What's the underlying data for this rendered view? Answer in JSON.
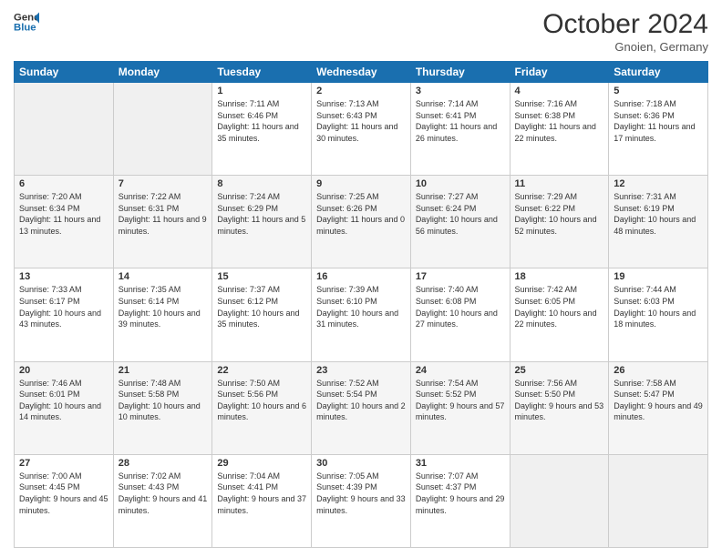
{
  "header": {
    "logo_line1": "General",
    "logo_line2": "Blue",
    "month_title": "October 2024",
    "location": "Gnoien, Germany"
  },
  "days_of_week": [
    "Sunday",
    "Monday",
    "Tuesday",
    "Wednesday",
    "Thursday",
    "Friday",
    "Saturday"
  ],
  "weeks": [
    [
      {
        "day": "",
        "sunrise": "",
        "sunset": "",
        "daylight": ""
      },
      {
        "day": "",
        "sunrise": "",
        "sunset": "",
        "daylight": ""
      },
      {
        "day": "1",
        "sunrise": "Sunrise: 7:11 AM",
        "sunset": "Sunset: 6:46 PM",
        "daylight": "Daylight: 11 hours and 35 minutes."
      },
      {
        "day": "2",
        "sunrise": "Sunrise: 7:13 AM",
        "sunset": "Sunset: 6:43 PM",
        "daylight": "Daylight: 11 hours and 30 minutes."
      },
      {
        "day": "3",
        "sunrise": "Sunrise: 7:14 AM",
        "sunset": "Sunset: 6:41 PM",
        "daylight": "Daylight: 11 hours and 26 minutes."
      },
      {
        "day": "4",
        "sunrise": "Sunrise: 7:16 AM",
        "sunset": "Sunset: 6:38 PM",
        "daylight": "Daylight: 11 hours and 22 minutes."
      },
      {
        "day": "5",
        "sunrise": "Sunrise: 7:18 AM",
        "sunset": "Sunset: 6:36 PM",
        "daylight": "Daylight: 11 hours and 17 minutes."
      }
    ],
    [
      {
        "day": "6",
        "sunrise": "Sunrise: 7:20 AM",
        "sunset": "Sunset: 6:34 PM",
        "daylight": "Daylight: 11 hours and 13 minutes."
      },
      {
        "day": "7",
        "sunrise": "Sunrise: 7:22 AM",
        "sunset": "Sunset: 6:31 PM",
        "daylight": "Daylight: 11 hours and 9 minutes."
      },
      {
        "day": "8",
        "sunrise": "Sunrise: 7:24 AM",
        "sunset": "Sunset: 6:29 PM",
        "daylight": "Daylight: 11 hours and 5 minutes."
      },
      {
        "day": "9",
        "sunrise": "Sunrise: 7:25 AM",
        "sunset": "Sunset: 6:26 PM",
        "daylight": "Daylight: 11 hours and 0 minutes."
      },
      {
        "day": "10",
        "sunrise": "Sunrise: 7:27 AM",
        "sunset": "Sunset: 6:24 PM",
        "daylight": "Daylight: 10 hours and 56 minutes."
      },
      {
        "day": "11",
        "sunrise": "Sunrise: 7:29 AM",
        "sunset": "Sunset: 6:22 PM",
        "daylight": "Daylight: 10 hours and 52 minutes."
      },
      {
        "day": "12",
        "sunrise": "Sunrise: 7:31 AM",
        "sunset": "Sunset: 6:19 PM",
        "daylight": "Daylight: 10 hours and 48 minutes."
      }
    ],
    [
      {
        "day": "13",
        "sunrise": "Sunrise: 7:33 AM",
        "sunset": "Sunset: 6:17 PM",
        "daylight": "Daylight: 10 hours and 43 minutes."
      },
      {
        "day": "14",
        "sunrise": "Sunrise: 7:35 AM",
        "sunset": "Sunset: 6:14 PM",
        "daylight": "Daylight: 10 hours and 39 minutes."
      },
      {
        "day": "15",
        "sunrise": "Sunrise: 7:37 AM",
        "sunset": "Sunset: 6:12 PM",
        "daylight": "Daylight: 10 hours and 35 minutes."
      },
      {
        "day": "16",
        "sunrise": "Sunrise: 7:39 AM",
        "sunset": "Sunset: 6:10 PM",
        "daylight": "Daylight: 10 hours and 31 minutes."
      },
      {
        "day": "17",
        "sunrise": "Sunrise: 7:40 AM",
        "sunset": "Sunset: 6:08 PM",
        "daylight": "Daylight: 10 hours and 27 minutes."
      },
      {
        "day": "18",
        "sunrise": "Sunrise: 7:42 AM",
        "sunset": "Sunset: 6:05 PM",
        "daylight": "Daylight: 10 hours and 22 minutes."
      },
      {
        "day": "19",
        "sunrise": "Sunrise: 7:44 AM",
        "sunset": "Sunset: 6:03 PM",
        "daylight": "Daylight: 10 hours and 18 minutes."
      }
    ],
    [
      {
        "day": "20",
        "sunrise": "Sunrise: 7:46 AM",
        "sunset": "Sunset: 6:01 PM",
        "daylight": "Daylight: 10 hours and 14 minutes."
      },
      {
        "day": "21",
        "sunrise": "Sunrise: 7:48 AM",
        "sunset": "Sunset: 5:58 PM",
        "daylight": "Daylight: 10 hours and 10 minutes."
      },
      {
        "day": "22",
        "sunrise": "Sunrise: 7:50 AM",
        "sunset": "Sunset: 5:56 PM",
        "daylight": "Daylight: 10 hours and 6 minutes."
      },
      {
        "day": "23",
        "sunrise": "Sunrise: 7:52 AM",
        "sunset": "Sunset: 5:54 PM",
        "daylight": "Daylight: 10 hours and 2 minutes."
      },
      {
        "day": "24",
        "sunrise": "Sunrise: 7:54 AM",
        "sunset": "Sunset: 5:52 PM",
        "daylight": "Daylight: 9 hours and 57 minutes."
      },
      {
        "day": "25",
        "sunrise": "Sunrise: 7:56 AM",
        "sunset": "Sunset: 5:50 PM",
        "daylight": "Daylight: 9 hours and 53 minutes."
      },
      {
        "day": "26",
        "sunrise": "Sunrise: 7:58 AM",
        "sunset": "Sunset: 5:47 PM",
        "daylight": "Daylight: 9 hours and 49 minutes."
      }
    ],
    [
      {
        "day": "27",
        "sunrise": "Sunrise: 7:00 AM",
        "sunset": "Sunset: 4:45 PM",
        "daylight": "Daylight: 9 hours and 45 minutes."
      },
      {
        "day": "28",
        "sunrise": "Sunrise: 7:02 AM",
        "sunset": "Sunset: 4:43 PM",
        "daylight": "Daylight: 9 hours and 41 minutes."
      },
      {
        "day": "29",
        "sunrise": "Sunrise: 7:04 AM",
        "sunset": "Sunset: 4:41 PM",
        "daylight": "Daylight: 9 hours and 37 minutes."
      },
      {
        "day": "30",
        "sunrise": "Sunrise: 7:05 AM",
        "sunset": "Sunset: 4:39 PM",
        "daylight": "Daylight: 9 hours and 33 minutes."
      },
      {
        "day": "31",
        "sunrise": "Sunrise: 7:07 AM",
        "sunset": "Sunset: 4:37 PM",
        "daylight": "Daylight: 9 hours and 29 minutes."
      },
      {
        "day": "",
        "sunrise": "",
        "sunset": "",
        "daylight": ""
      },
      {
        "day": "",
        "sunrise": "",
        "sunset": "",
        "daylight": ""
      }
    ]
  ]
}
